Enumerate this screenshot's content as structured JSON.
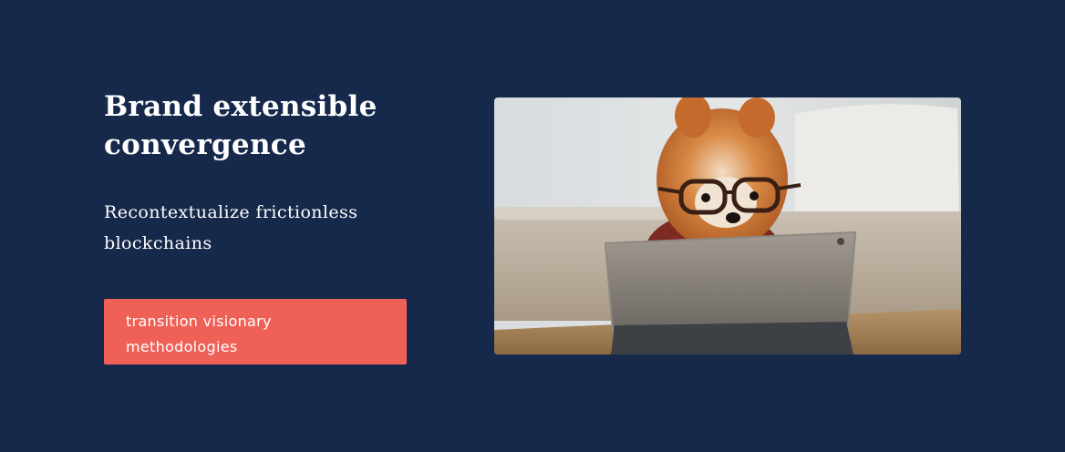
{
  "hero": {
    "headline": "Brand extensible convergence",
    "subtext": "Recontextualize frictionless blockchains",
    "cta_label": "transition visionary methodologies",
    "image_alt": "Pomeranian dog wearing glasses looking at a tablet"
  },
  "colors": {
    "background": "#16294b",
    "cta": "#ef6157",
    "text": "#ffffff"
  }
}
